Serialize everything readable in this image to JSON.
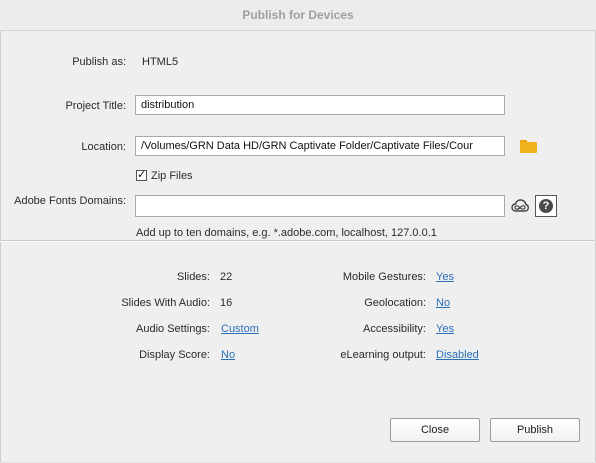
{
  "window": {
    "title": "Publish for Devices"
  },
  "publish_as": {
    "label": "Publish as:",
    "value": "HTML5"
  },
  "project_title": {
    "label": "Project Title:",
    "value": "distribution"
  },
  "location": {
    "label": "Location:",
    "value": "/Volumes/GRN Data HD/GRN Captivate Folder/Captivate Files/Cour",
    "icon": "folder-icon"
  },
  "zip_files": {
    "label": "Zip Files",
    "checked": true
  },
  "fonts_domains": {
    "label": "Adobe Fonts Domains:",
    "value": "",
    "hint": "Add up to ten domains, e.g. *.adobe.com, localhost, 127.0.0.1",
    "icons": [
      "creative-cloud-icon",
      "help-icon"
    ]
  },
  "summary": {
    "slides": {
      "label": "Slides:",
      "value": "22"
    },
    "slides_audio": {
      "label": "Slides With Audio:",
      "value": "16"
    },
    "audio_settings": {
      "label": "Audio Settings:",
      "value": "Custom"
    },
    "display_score": {
      "label": "Display Score:",
      "value": "No"
    },
    "mobile_gestures": {
      "label": "Mobile Gestures:",
      "value": "Yes"
    },
    "geolocation": {
      "label": "Geolocation:",
      "value": "No"
    },
    "accessibility": {
      "label": "Accessibility:",
      "value": "Yes"
    },
    "elearning_output": {
      "label": "eLearning output:",
      "value": "Disabled"
    }
  },
  "buttons": {
    "close": "Close",
    "publish": "Publish"
  },
  "colors": {
    "link": "#2a6fb8",
    "folder": "#f0b21b",
    "background": "#efefef"
  }
}
